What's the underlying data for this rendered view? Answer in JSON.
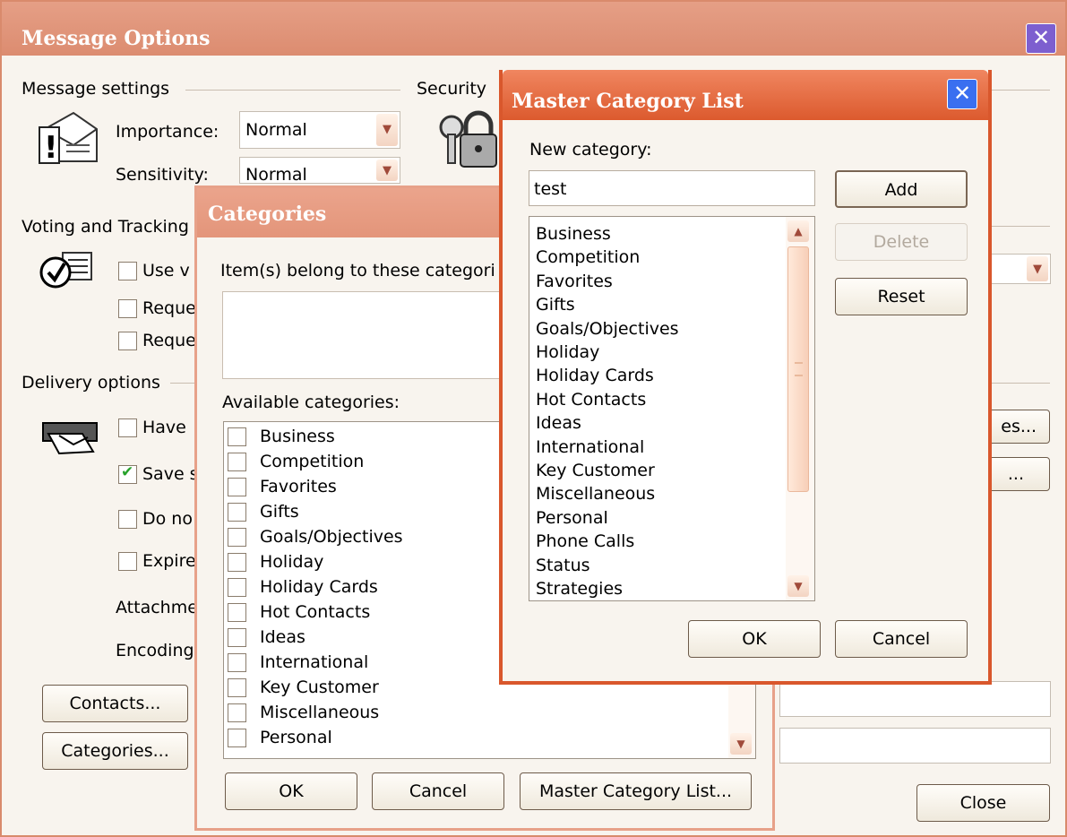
{
  "message_options": {
    "title": "Message Options",
    "sections": {
      "message_settings": "Message settings",
      "security": "Security",
      "voting": "Voting and Tracking",
      "delivery": "Delivery options"
    },
    "importance_label": "Importance:",
    "importance_value": "Normal",
    "sensitivity_label": "Sensitivity:",
    "sensitivity_value": "Normal",
    "voting_items": [
      "Use v",
      "Reque",
      "Reque"
    ],
    "delivery_items": [
      "Have",
      "Save s",
      "Do no",
      "Expire"
    ],
    "save_checked": true,
    "attachment_label": "Attachme",
    "encoding_label": "Encoding",
    "contacts_button": "Contacts...",
    "categories_button": "Categories...",
    "close_button": "Close",
    "right_button_1": "es...",
    "right_button_2": "..."
  },
  "categories_dialog": {
    "title": "Categories",
    "belong_label": "Item(s) belong to these categori",
    "available_label": "Available categories:",
    "items": [
      "Business",
      "Competition",
      "Favorites",
      "Gifts",
      "Goals/Objectives",
      "Holiday",
      "Holiday Cards",
      "Hot Contacts",
      "Ideas",
      "International",
      "Key Customer",
      "Miscellaneous",
      "Personal"
    ],
    "ok_button": "OK",
    "cancel_button": "Cancel",
    "master_button": "Master Category List..."
  },
  "master_dialog": {
    "title": "Master Category List",
    "new_label": "New category:",
    "new_value": "test",
    "items": [
      "Business",
      "Competition",
      "Favorites",
      "Gifts",
      "Goals/Objectives",
      "Holiday",
      "Holiday Cards",
      "Hot Contacts",
      "Ideas",
      "International",
      "Key Customer",
      "Miscellaneous",
      "Personal",
      "Phone Calls",
      "Status",
      "Strategies"
    ],
    "add_button": "Add",
    "delete_button": "Delete",
    "reset_button": "Reset",
    "ok_button": "OK",
    "cancel_button": "Cancel"
  },
  "colors": {
    "title_bar": "#e9967a",
    "dialog_face": "#f8f4ee",
    "close_blue": "#3a6ff0"
  }
}
